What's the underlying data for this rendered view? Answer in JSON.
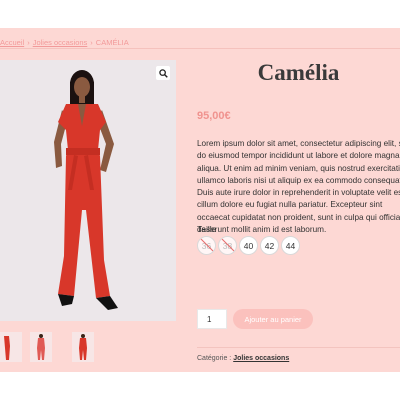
{
  "breadcrumb": {
    "items": [
      "Accueil",
      "Jolies occasions"
    ],
    "separator": "›",
    "current": "CAMÉLIA"
  },
  "product": {
    "title": "Camélia",
    "price": "95,00€",
    "description": "Lorem ipsum dolor sit amet, consectetur adipiscing elit, sed do eiusmod tempor incididunt ut labore et dolore magna aliqua. Ut enim ad minim veniam, quis nostrud exercitation ullamco laboris nisi ut aliquip ex ea commodo consequat. Duis aute irure dolor in reprehenderit in voluptate velit esse cillum dolore eu fugiat nulla pariatur. Excepteur sint occaecat cupidatat non proident, sunt in culpa qui officia deserunt mollit anim id est laborum.",
    "size_label": "Taille",
    "sizes": [
      {
        "label": "36",
        "available": false
      },
      {
        "label": "38",
        "available": false
      },
      {
        "label": "40",
        "available": true
      },
      {
        "label": "42",
        "available": true
      },
      {
        "label": "44",
        "available": true
      }
    ],
    "quantity": "1",
    "add_to_cart_label": "Ajouter au panier",
    "category_label": "Catégorie :",
    "category_value": "Jolies occasions"
  },
  "gallery": {
    "zoom_icon": "magnifier-icon",
    "dress_color": "#d8372a",
    "thumbnail_count": 3
  },
  "colors": {
    "page_background": "#fdd8d4",
    "accent": "#f0938f",
    "button": "#fbc1bd"
  }
}
